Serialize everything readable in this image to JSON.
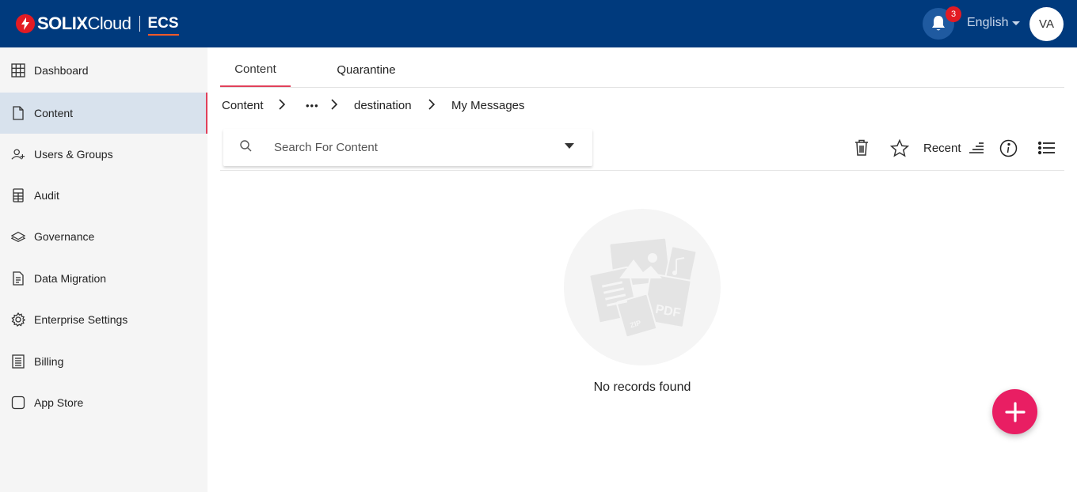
{
  "header": {
    "brand_name_bold": "SOLIX",
    "brand_name_light": "Cloud",
    "product": "ECS",
    "notification_count": "3",
    "language": "English",
    "user_initials": "VA",
    "colors": {
      "bar": "#003a7d",
      "badge": "#e31b23"
    }
  },
  "sidebar": {
    "items": [
      {
        "label": "Dashboard",
        "icon": "grid-icon"
      },
      {
        "label": "Content",
        "icon": "file-icon",
        "active": true
      },
      {
        "label": "Users & Groups",
        "icon": "add-user-icon"
      },
      {
        "label": "Audit",
        "icon": "calculator-icon"
      },
      {
        "label": "Governance",
        "icon": "layers-icon"
      },
      {
        "label": "Data Migration",
        "icon": "document-icon"
      },
      {
        "label": "Enterprise Settings",
        "icon": "gear-icon"
      },
      {
        "label": "Billing",
        "icon": "receipt-icon"
      },
      {
        "label": "App Store",
        "icon": "square-icon"
      }
    ]
  },
  "tabs": {
    "content": "Content",
    "quarantine": "Quarantine",
    "active": "Content"
  },
  "breadcrumb": {
    "root": "Content",
    "ellipsis": "•••",
    "folder": "destination",
    "current": "My Messages"
  },
  "search": {
    "placeholder": "Search For Content",
    "value": ""
  },
  "toolbar": {
    "sort_label": "Recent"
  },
  "empty_state": {
    "message": "No records found"
  },
  "fab": {
    "accent": "#e91e63"
  }
}
